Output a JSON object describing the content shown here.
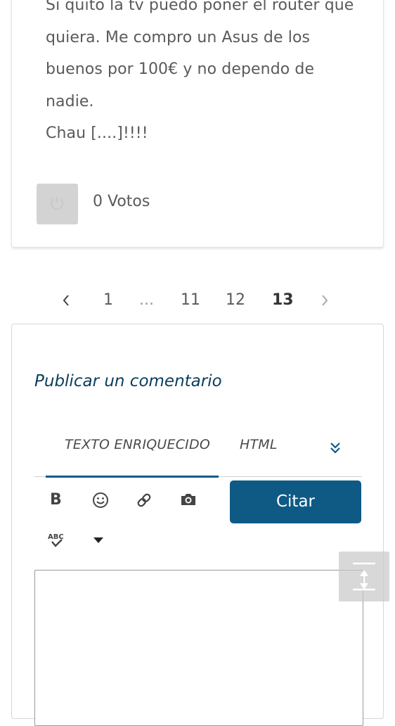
{
  "post": {
    "lines": [
      "Si quito la tv puedo poner el router que",
      "quiera. Me compro un Asus de los",
      "buenos por 100€ y no dependo de",
      "nadie.",
      "Chau [....]!!!!"
    ],
    "votes_label": "0 Votos"
  },
  "pagination": {
    "prev": "‹",
    "pages": [
      "1",
      "...",
      "11",
      "12",
      "13"
    ],
    "current": "13",
    "next": "›"
  },
  "comment": {
    "title": "Publicar un comentario",
    "tabs": [
      "TEXTO ENRIQUECIDO",
      "HTML"
    ],
    "active_tab": "TEXTO ENRIQUECIDO",
    "toolbar": {
      "bold_label": "B",
      "quote_button": "Citar",
      "icons": [
        "bold-icon",
        "emoji-icon",
        "link-icon",
        "camera-icon",
        "spellcheck-icon",
        "dropdown-caret-icon"
      ]
    },
    "editor_value": ""
  },
  "colors": {
    "accent": "#0e5a85",
    "title": "#0b3d5c",
    "vote_button": "#d3d3d3"
  }
}
